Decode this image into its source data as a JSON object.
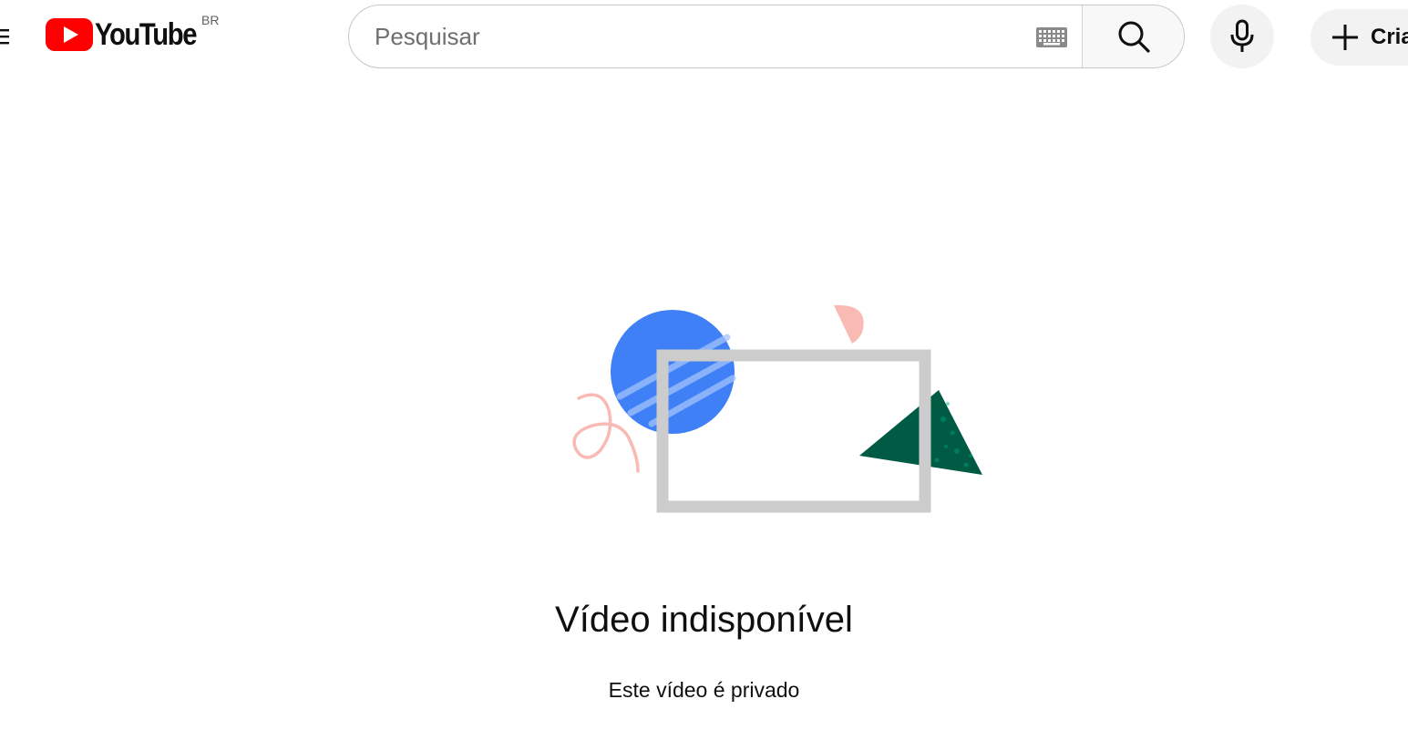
{
  "header": {
    "logo_text": "YouTube",
    "country_code": "BR",
    "search_placeholder": "Pesquisar",
    "create_label": "Criar"
  },
  "icons": {
    "menu": "menu-icon",
    "logo": "youtube-logo-icon",
    "keyboard": "keyboard-icon",
    "search": "search-icon",
    "mic": "mic-icon",
    "create": "plus-icon",
    "illustration": "video-unavailable-illustration"
  },
  "main": {
    "title": "Vídeo indisponível",
    "message": "Este vídeo é privado"
  },
  "colors": {
    "brand_red": "#ff0000",
    "illustration_blue": "#3f80f7",
    "illustration_green": "#005b45",
    "illustration_pink": "#f9bab4",
    "illustration_frame": "#cccccc"
  }
}
